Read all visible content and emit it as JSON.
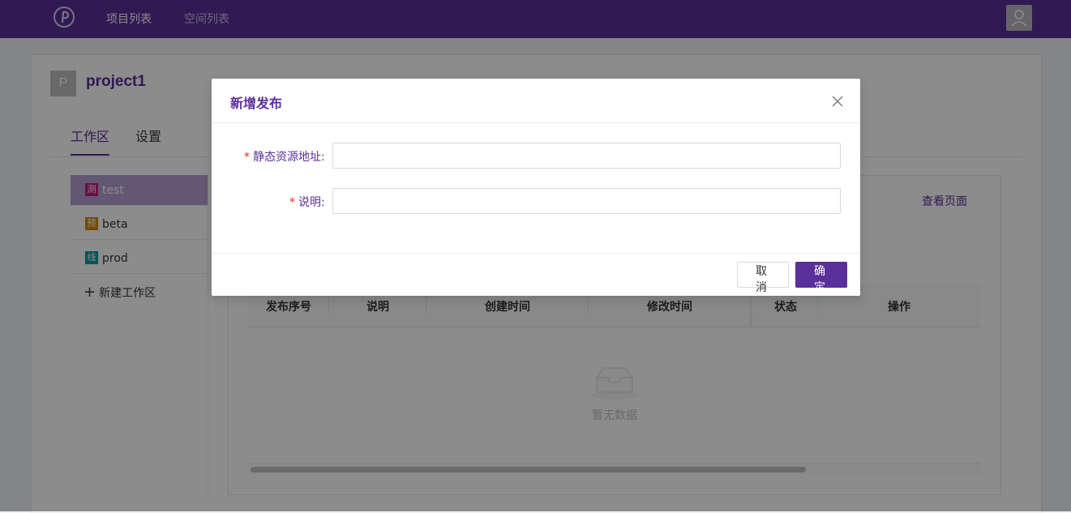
{
  "topnav": {
    "projects": "项目列表",
    "spaces": "空间列表"
  },
  "project": {
    "initial": "P",
    "name": "project1"
  },
  "tabs": [
    {
      "label": "工作区"
    },
    {
      "label": "设置"
    }
  ],
  "workspaces": [
    {
      "tag": "测",
      "name": "test",
      "color": "#c41d7f"
    },
    {
      "tag": "预",
      "name": "beta",
      "color": "#d48806"
    },
    {
      "tag": "线",
      "name": "prod",
      "color": "#08979c"
    }
  ],
  "new_workspace": "新建工作区",
  "view_page": "查看页面",
  "table": {
    "columns": [
      "发布序号",
      "说明",
      "创建时间",
      "修改时间",
      "状态",
      "操作"
    ],
    "empty_text": "暂无数据"
  },
  "modal": {
    "title": "新增发布",
    "fields": [
      {
        "label": "静态资源地址",
        "value": "",
        "required": true
      },
      {
        "label": "说明",
        "value": "",
        "required": true
      }
    ],
    "cancel": "取消",
    "ok": "确定"
  },
  "colors": {
    "brand": "#5a2f9a",
    "required": "#f5222d"
  }
}
